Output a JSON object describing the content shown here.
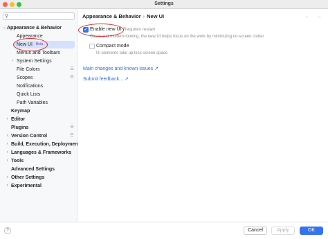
{
  "window": {
    "title": "Settings"
  },
  "sidebar": {
    "search": {
      "placeholder": ""
    },
    "items": [
      {
        "label": "Appearance & Behavior",
        "expanded": true
      },
      {
        "label": "Appearance"
      },
      {
        "label": "New UI",
        "badge": "Beta",
        "selected": true
      },
      {
        "label": "Menus and Toolbars"
      },
      {
        "label": "System Settings",
        "collapsed": true
      },
      {
        "label": "File Colors"
      },
      {
        "label": "Scopes"
      },
      {
        "label": "Notifications"
      },
      {
        "label": "Quick Lists"
      },
      {
        "label": "Path Variables"
      },
      {
        "label": "Keymap"
      },
      {
        "label": "Editor"
      },
      {
        "label": "Plugins"
      },
      {
        "label": "Version Control"
      },
      {
        "label": "Build, Execution, Deployment"
      },
      {
        "label": "Languages & Frameworks"
      },
      {
        "label": "Tools"
      },
      {
        "label": "Advanced Settings"
      },
      {
        "label": "Other Settings"
      },
      {
        "label": "Experimental"
      }
    ]
  },
  "content": {
    "breadcrumb": {
      "parent": "Appearance & Behavior",
      "separator": "›",
      "current": "New UI"
    },
    "nav": {
      "back": "←",
      "forward": "→"
    },
    "options": [
      {
        "label": "Enable new UI",
        "checked": true,
        "note": "Requires restart",
        "description": "Clean and modern-looking, the new UI helps focus on the work by minimizing on-screen clutter"
      },
      {
        "label": "Compact mode",
        "checked": false,
        "description": "UI elements take up less screen space"
      }
    ],
    "links": [
      {
        "label": "Main changes and known issues ↗"
      },
      {
        "label": "Submit feedback... ↗"
      }
    ]
  },
  "footer": {
    "help": "?",
    "cancel": "Cancel",
    "apply": "Apply",
    "ok": "OK"
  },
  "colors": {
    "accent": "#3574f0",
    "selection": "#d5e1fb",
    "annotation": "#d62b2b",
    "badge_bg": "#e3defd",
    "link": "#2f6dd8"
  }
}
